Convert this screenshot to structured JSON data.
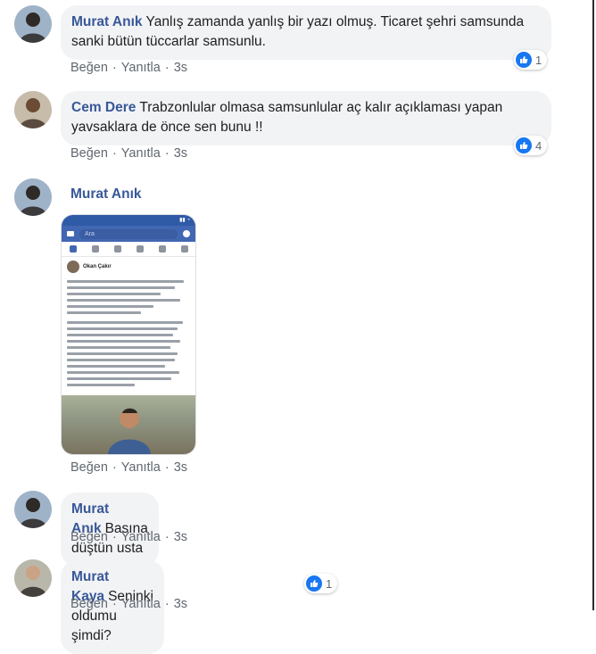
{
  "actions": {
    "like": "Beğen",
    "reply": "Yanıtla",
    "sep": "·",
    "time": "3s"
  },
  "comments": [
    {
      "author": "Murat Anık",
      "text": "Yanlış zamanda yanlış bir yazı olmuş. Ticaret şehri samsunda sanki bütün tüccarlar samsunlu.",
      "reactions": "1"
    },
    {
      "author": "Cem Dere",
      "text": "Trabzonlular olmasa samsunlular aç kalır açıklaması yapan yavsaklara de önce sen bunu !!",
      "reactions": "4"
    },
    {
      "author": "Murat Anık",
      "text": "",
      "reactions": ""
    },
    {
      "author": "Murat Anık",
      "text": "Basına düştün usta",
      "reactions": ""
    },
    {
      "author": "Murat Kaya",
      "text": "Seninki oldumu şimdi?",
      "reactions": "1"
    }
  ],
  "screenshot": {
    "search_placeholder": "Ara",
    "post_author": "Okan Çakır"
  },
  "colors": {
    "link": "#385898",
    "bubble": "#f2f3f5",
    "like": "#1877f2"
  }
}
